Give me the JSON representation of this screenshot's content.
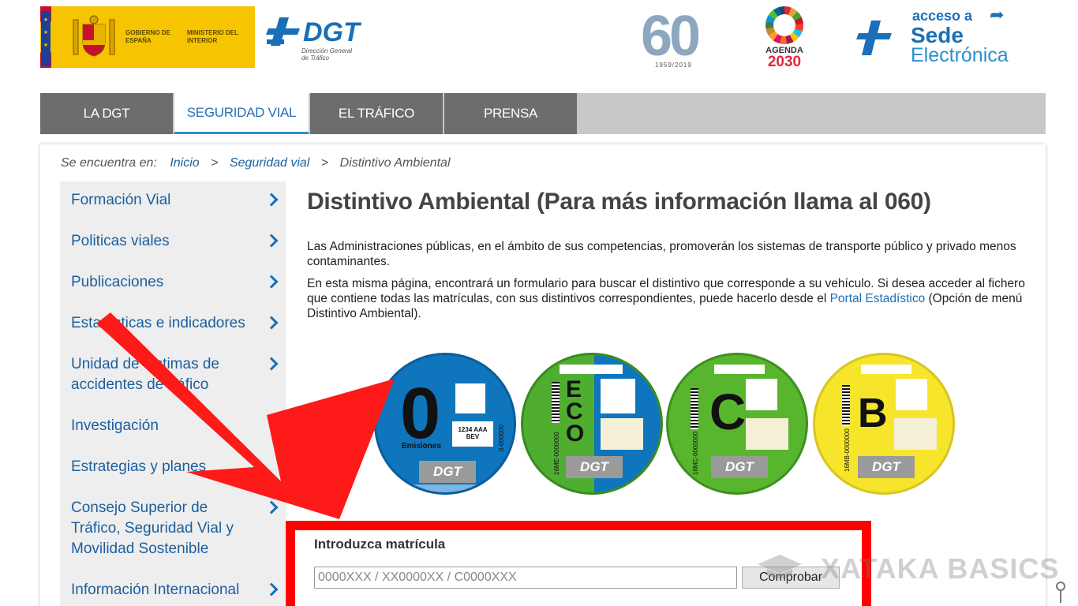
{
  "header": {
    "gov_line1": "GOBIERNO DE ESPAÑA",
    "gov_line2": "MINISTERIO DEL INTERIOR",
    "dgt_name": "DGT",
    "dgt_subtitle": "Dirección General de Tráfico",
    "anniv_number": "60",
    "anniv_years": "1959/2019",
    "agenda_l1": "AGENDA",
    "agenda_l2": "2030",
    "sede_l1": "acceso a",
    "sede_l2": "Sede",
    "sede_l3": "Electrónica"
  },
  "nav": {
    "tabs": [
      "LA DGT",
      "SEGURIDAD VIAL",
      "EL TRÁFICO",
      "PRENSA"
    ]
  },
  "breadcrumb": {
    "prefix": "Se encuentra en:",
    "items": [
      "Inicio",
      "Seguridad vial",
      "Distintivo Ambiental"
    ],
    "sep": ">"
  },
  "sidebar": {
    "items": [
      "Formación Vial",
      "Politicas viales",
      "Publicaciones",
      "Estadísticas e indicadores",
      "Unidad de víctimas de accidentes de tráfico",
      "Investigación",
      "Estrategias y planes",
      "Consejo Superior de Tráfico, Seguridad Vial y Movilidad Sostenible",
      "Información Internacional"
    ]
  },
  "main": {
    "title": "Distintivo Ambiental (Para más información llama al 060)",
    "para1": "Las Administraciones públicas, en el ámbito de sus competencias, promoverán los sistemas de transporte público y privado menos contaminantes.",
    "para2_start": "En esta misma página, encontrará un formulario para buscar  el distintivo que corresponde a su vehículo. Si desea acceder al fichero que contiene todas las matrículas, con sus distintivos correspondientes, puede hacerlo desde el ",
    "para2_link": "Portal Estadístico",
    "para2_end": " (Opción de menú Distintivo Ambiental)."
  },
  "stickers": [
    {
      "letter": "0",
      "sub": "Emisiones",
      "plate": "1234 AAA",
      "plate2": "BEV",
      "code": "0-000000",
      "color": "#0f75bc"
    },
    {
      "letter": "ECO",
      "code": "16ME-0000000",
      "color": "#4fae2f"
    },
    {
      "letter": "C",
      "code": "16MC-0000000",
      "color": "#58b52e"
    },
    {
      "letter": "B",
      "code": "16MB-0000000",
      "color": "#f6e52a"
    }
  ],
  "sticker_brand": "DGT",
  "form": {
    "label": "Introduzca matrícula",
    "placeholder": "0000XXX / XX0000XX / C0000XXX",
    "value": "",
    "button": "Comprobar"
  },
  "watermark": "XATAKA BASICS",
  "colors": {
    "brand_blue": "#1a6fb8",
    "nav_grey": "#6d6d6d",
    "highlight_red": "#ff0000",
    "gov_yellow": "#f6c400"
  }
}
